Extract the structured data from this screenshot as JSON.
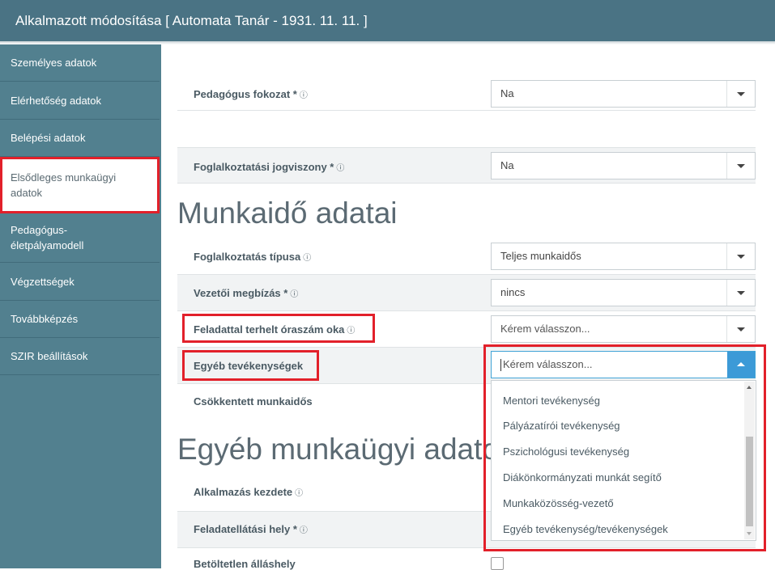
{
  "window": {
    "title": "Alkalmazott módosítása [ Automata Tanár - 1931. 11. 11. ]"
  },
  "sidebar": {
    "items": [
      {
        "label": "Személyes adatok"
      },
      {
        "label": "Elérhetőség adatok"
      },
      {
        "label": "Belépési adatok"
      },
      {
        "label": "Elsődleges munkaügyi adatok"
      },
      {
        "label": "Pedagógus-életpályamodell"
      },
      {
        "label": "Végzettségek"
      },
      {
        "label": "Továbbképzés"
      },
      {
        "label": "SZIR beállítások"
      }
    ]
  },
  "fields": {
    "pedagogus_fokozat": {
      "label": "Pedagógus fokozat *",
      "value": "Na"
    },
    "foglalkoztatasi_jogviszony": {
      "label": "Foglalkoztatási jogviszony *",
      "value": "Na"
    },
    "foglalkoztatas_tipusa": {
      "label": "Foglalkoztatás típusa",
      "value": "Teljes munkaidős"
    },
    "vezetoi_megbizas": {
      "label": "Vezetői megbízás *",
      "value": "nincs"
    },
    "feladattal_terhelt": {
      "label": "Feladattal terhelt óraszám oka",
      "value": "Kérem válasszon..."
    },
    "egyeb_tevekenysegek": {
      "label": "Egyéb tevékenységek",
      "value": "Kérem válasszon..."
    },
    "csokkentett_munkaidos": {
      "label": "Csökkentett munkaidős"
    },
    "alkalmazas_kezdete": {
      "label": "Alkalmazás kezdete"
    },
    "feladatellatasi_hely": {
      "label": "Feladatellátási hely *"
    },
    "betoltetlen_allashely": {
      "label": "Betöltetlen álláshely"
    }
  },
  "sections": {
    "munkaido": "Munkaidő adatai",
    "egyeb": "Egyéb munkaügyi adatok"
  },
  "dropdown": {
    "options": [
      "Mentori tevékenység",
      "Pályázatírói tevékenység",
      "Pszichológusi tevékenység",
      "Diákönkormányzati munkát segítő",
      "Munkaközösség-vezető",
      "Egyéb tevékenység/tevékenységek"
    ]
  },
  "icons": {
    "info": "ⓘ"
  },
  "colors": {
    "header": "#4a7384",
    "sidebar": "#52808f",
    "highlight": "#e2202a",
    "accent": "#3c9ad7"
  }
}
